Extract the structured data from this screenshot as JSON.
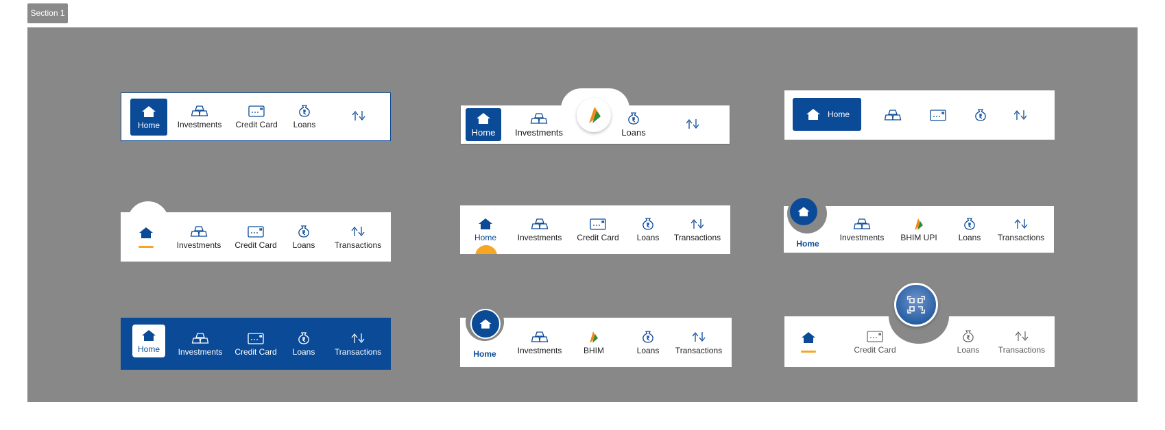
{
  "section": {
    "label": "Section 1"
  },
  "colors": {
    "primary": "#0b4a96",
    "accent": "#f5a623",
    "canvas": "#888888",
    "surface": "#ffffff"
  },
  "icons": {
    "home": "home-icon",
    "investments": "gold-bars-icon",
    "credit_card": "credit-card-icon",
    "loans": "rupee-money-bag-icon",
    "transactions": "up-down-arrows-icon",
    "bhim": "bhim-logo-icon",
    "qr": "qr-scan-icon"
  },
  "variants": {
    "v1": {
      "home": "Home",
      "investments": "Investments",
      "credit": "Credit Card",
      "loans": "Loans",
      "tx": "Transactions"
    },
    "v2": {
      "home": "Home",
      "investments": "Investments",
      "loans": "Loans",
      "tx": "Transactions"
    },
    "v3": {
      "home": "Home"
    },
    "v4": {
      "investments": "Investments",
      "credit": "Credit Card",
      "loans": "Loans",
      "tx": "Transactions"
    },
    "v5": {
      "home": "Home",
      "investments": "Investments",
      "credit": "Credit Card",
      "loans": "Loans",
      "tx": "Transactions"
    },
    "v6": {
      "home": "Home",
      "investments": "Investments",
      "bhim": "BHIM UPI",
      "loans": "Loans",
      "tx": "Transactions"
    },
    "v7": {
      "home": "Home",
      "investments": "Investments",
      "credit": "Credit Card",
      "loans": "Loans",
      "tx": "Transactions"
    },
    "v8": {
      "home": "Home",
      "investments": "Investments",
      "bhim": "BHIM",
      "loans": "Loans",
      "tx": "Transactions"
    },
    "v9": {
      "credit": "Credit Card",
      "loans": "Loans",
      "tx": "Transactions"
    }
  }
}
